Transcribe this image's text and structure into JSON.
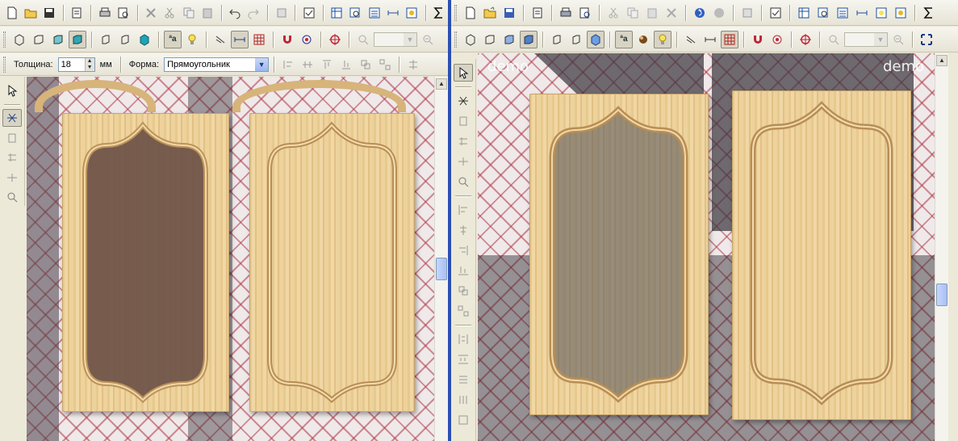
{
  "left": {
    "thickness_label": "Толщина:",
    "thickness_value": "18",
    "thickness_unit": "мм",
    "shape_label": "Форма:",
    "shape_value": "Прямоугольник"
  },
  "right": {
    "watermark_left": "demo",
    "watermark_right": "demo"
  },
  "icons": {
    "font_toggle": "ªa"
  },
  "colors": {
    "pane_divider": "#2b4fb3",
    "toolbar_bg": "#ece9d8",
    "wallpaper_pattern": "#b03a48",
    "wood": "#e7c98e"
  }
}
